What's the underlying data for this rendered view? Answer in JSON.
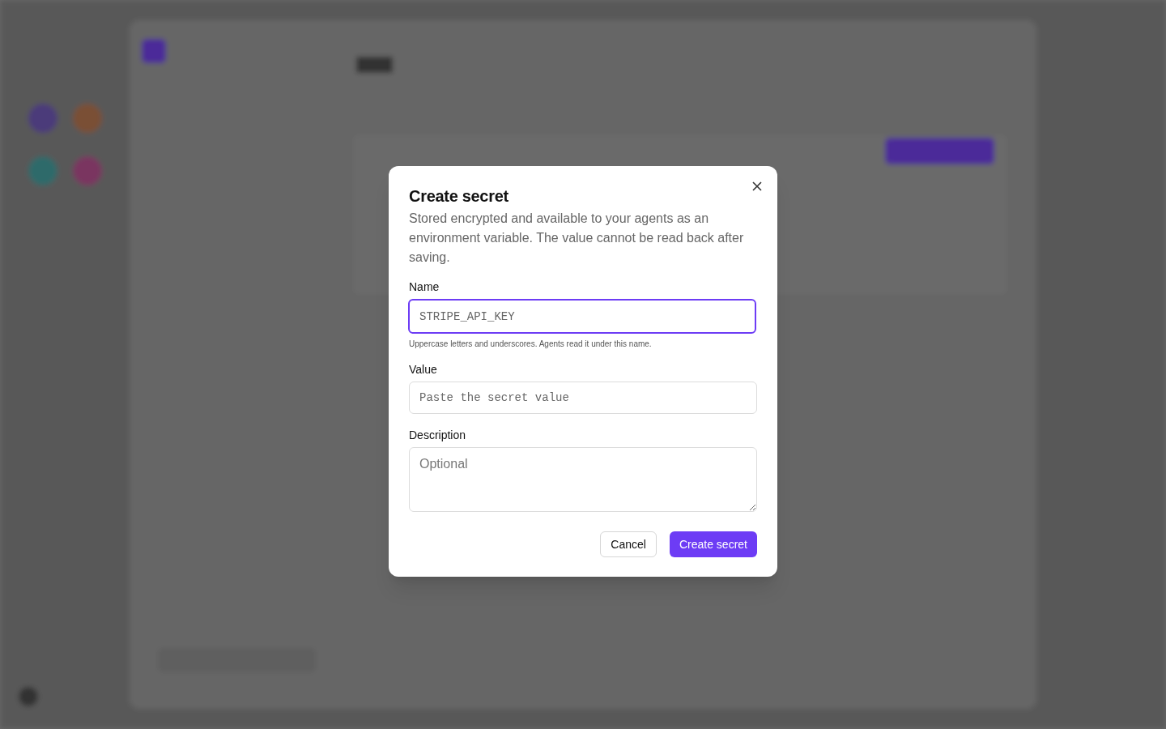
{
  "dialog": {
    "title": "Create secret",
    "description": "Stored encrypted and available to your agents as an environment variable. The value cannot be read back after saving.",
    "fields": [
      {
        "kind": "input",
        "label": "Name",
        "placeholder": "STRIPE_API_KEY",
        "focused": true,
        "hint": "Uppercase letters and underscores. Agents read it under this name."
      },
      {
        "kind": "input",
        "label": "Value",
        "placeholder": "Paste the secret value",
        "focused": false
      },
      {
        "kind": "textarea",
        "label": "Description",
        "placeholder": "Optional",
        "focused": false
      }
    ],
    "buttons": [
      {
        "kind": "secondary",
        "label": "Cancel"
      },
      {
        "kind": "primary",
        "label": "Create secret"
      }
    ]
  }
}
